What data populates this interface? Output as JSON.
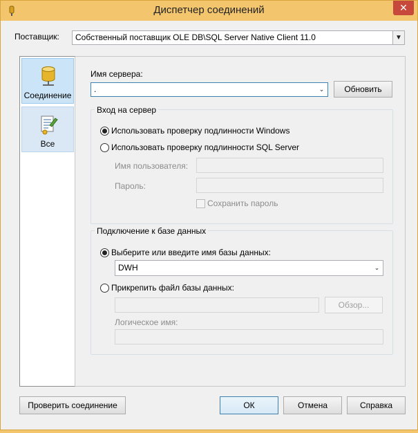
{
  "window": {
    "title": "Диспетчер соединений",
    "close_glyph": "✕",
    "accent": "#f3c66e",
    "close_color": "#c7493c"
  },
  "provider": {
    "label": "Поставщик:",
    "value": "Собственный поставщик OLE DB\\SQL Server Native Client 11.0"
  },
  "sidebar": {
    "items": [
      {
        "label": "Соединение",
        "icon": "database-icon",
        "selected": true
      },
      {
        "label": "Все",
        "icon": "properties-icon",
        "selected": false
      }
    ]
  },
  "server": {
    "label": "Имя сервера:",
    "value": ".",
    "refresh_label": "Обновить"
  },
  "logon": {
    "title": "Вход на сервер",
    "windows_auth_label": "Использовать проверку подлинности Windows",
    "sql_auth_label": "Использовать проверку подлинности SQL Server",
    "selected": "windows",
    "username_label": "Имя пользователя:",
    "username_value": "",
    "password_label": "Пароль:",
    "password_value": "",
    "save_password_label": "Сохранить пароль",
    "save_password_checked": false
  },
  "database": {
    "title": "Подключение к базе данных",
    "select_db_label": "Выберите или введите имя базы данных:",
    "db_value": "DWH",
    "attach_label": "Прикрепить файл базы данных:",
    "attach_value": "",
    "browse_label": "Обзор...",
    "logical_name_label": "Логическое имя:",
    "logical_name_value": "",
    "selected": "select"
  },
  "buttons": {
    "test": "Проверить соединение",
    "ok": "ОК",
    "cancel": "Отмена",
    "help": "Справка"
  }
}
